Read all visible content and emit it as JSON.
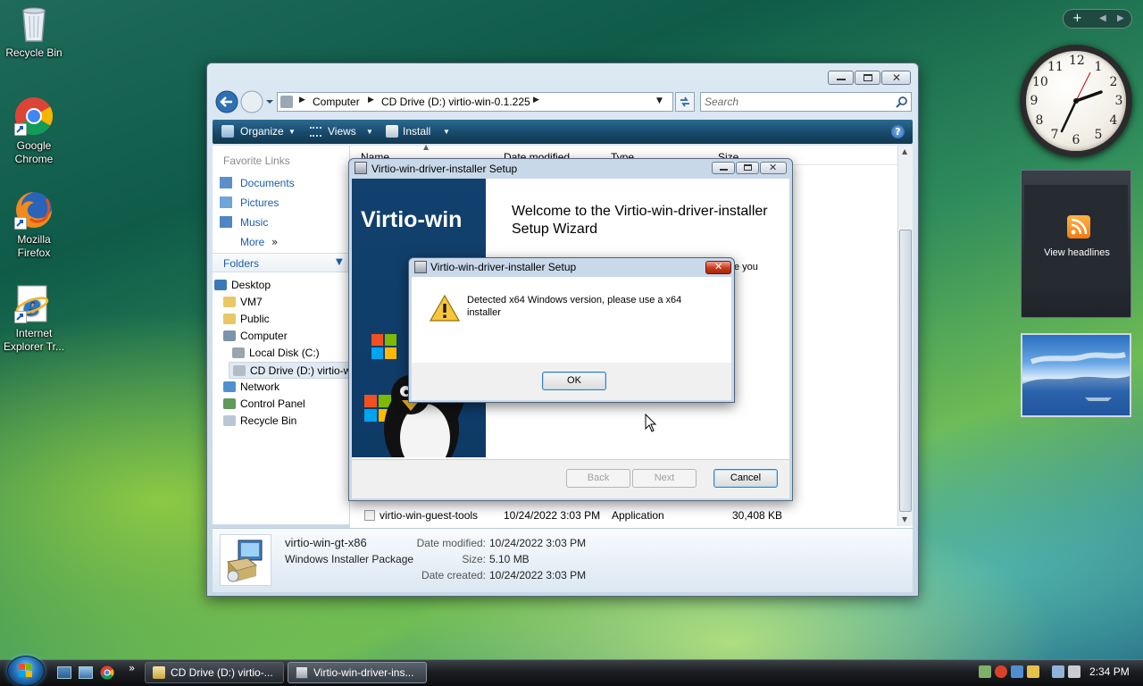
{
  "desktop": {
    "icons": [
      {
        "label": "Recycle Bin"
      },
      {
        "label": "Google Chrome"
      },
      {
        "label": "Mozilla Firefox"
      },
      {
        "label": "Internet Explorer Tr..."
      }
    ]
  },
  "sidebar": {
    "feed_label": "View headlines",
    "clock_numbers": [
      "12",
      "1",
      "2",
      "3",
      "4",
      "5",
      "6",
      "7",
      "8",
      "9",
      "10",
      "11"
    ]
  },
  "explorer": {
    "breadcrumb": [
      "Computer",
      "CD Drive (D:) virtio-win-0.1.225"
    ],
    "search_placeholder": "Search",
    "toolbar": {
      "organize": "Organize",
      "views": "Views",
      "install": "Install"
    },
    "nav": {
      "favorite_links_heading": "Favorite Links",
      "favorites": [
        "Documents",
        "Pictures",
        "Music"
      ],
      "more": "More",
      "folders_heading": "Folders",
      "tree": [
        "Desktop",
        "VM7",
        "Public",
        "Computer",
        "Local Disk (C:)",
        "CD Drive (D:) virtio-w",
        "Network",
        "Control Panel",
        "Recycle Bin"
      ]
    },
    "columns": [
      "Name",
      "Date modified",
      "Type",
      "Size"
    ],
    "visible_row": {
      "name": "virtio-win-guest-tools",
      "date": "10/24/2022 3:03 PM",
      "type": "Application",
      "size": "30,408 KB"
    },
    "details": {
      "file_name": "virtio-win-gt-x86",
      "file_type": "Windows Installer Package",
      "date_modified_label": "Date modified:",
      "date_modified": "10/24/2022 3:03 PM",
      "size_label": "Size:",
      "size": "5.10 MB",
      "date_created_label": "Date created:",
      "date_created": "10/24/2022 3:03 PM"
    }
  },
  "wizard": {
    "title": "Virtio-win-driver-installer Setup",
    "banner_text": "Virtio-win",
    "heading_line1": "Welcome to the Virtio-win-driver-installer",
    "heading_line2": "Setup Wizard",
    "partial_text": "e you",
    "back": "Back",
    "next": "Next",
    "cancel": "Cancel"
  },
  "msgbox": {
    "title": "Virtio-win-driver-installer Setup",
    "message_line1": "Detected x64 Windows version, please use a x64",
    "message_line2": "installer",
    "ok": "OK"
  },
  "taskbar": {
    "tasks": [
      "CD Drive (D:) virtio-...",
      "Virtio-win-driver-ins..."
    ],
    "time": "2:34 PM",
    "chevron": "»"
  }
}
